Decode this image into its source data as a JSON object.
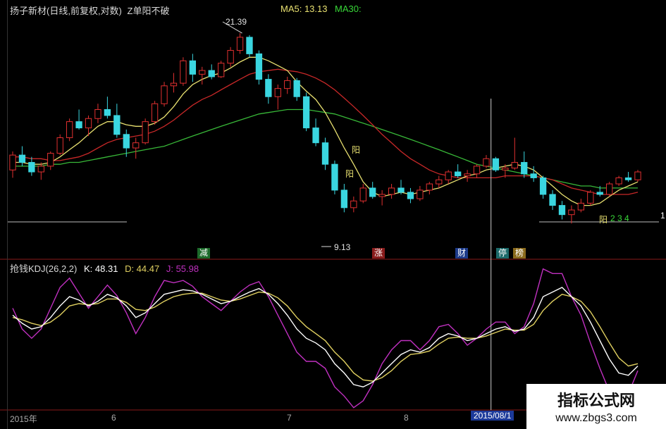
{
  "top_panel": {
    "title": "扬子新材(日线,前复权,对数)",
    "indicator": "Z单阳不破",
    "ma5_label": "MA5: 13.13",
    "ma30_label": "MA30:",
    "high_label": "21.39",
    "low_label": "9.13",
    "tags": [
      "减",
      "涨",
      "财",
      "停",
      "榜"
    ],
    "yang_labels": [
      "阳",
      "阳",
      "阳",
      "2 3 4"
    ],
    "right_marker": "1"
  },
  "bottom_panel": {
    "title": "抢钱KDJ(26,2,2)",
    "k_label": "K: 48.31",
    "d_label": "D: 44.47",
    "j_label": "J: 55.98"
  },
  "x_axis": {
    "labels": [
      "2015年",
      "6",
      "7",
      "8"
    ],
    "cursor_date": "2015/08/1"
  },
  "watermark": {
    "line1": "指标公式网",
    "line2": "www.zbgs3.com"
  },
  "colors": {
    "up": "#e03030",
    "down": "#3ad6e0",
    "ma5": "#e8e070",
    "ma10": "#c82828",
    "ma30": "#38b838",
    "k": "#ffffff",
    "d": "#e0d060",
    "j": "#c030c0"
  },
  "chart_data": [
    {
      "type": "candlestick",
      "title": "扬子新材(日线,前复权,对数)",
      "ylim": [
        8.5,
        23
      ],
      "log_scale": true,
      "x_ticks": [
        "2015年",
        "6",
        "7",
        "8"
      ],
      "ohlc": [
        [
          11.6,
          12.6,
          11.2,
          12.4
        ],
        [
          12.4,
          12.9,
          11.8,
          12.0
        ],
        [
          12.0,
          12.3,
          11.3,
          11.5
        ],
        [
          11.5,
          12.0,
          11.1,
          11.8
        ],
        [
          11.8,
          12.6,
          11.6,
          12.5
        ],
        [
          12.5,
          13.6,
          12.4,
          13.4
        ],
        [
          13.4,
          14.6,
          13.2,
          14.4
        ],
        [
          14.4,
          15.2,
          13.9,
          14.0
        ],
        [
          14.0,
          14.8,
          13.5,
          14.6
        ],
        [
          14.6,
          15.6,
          14.3,
          15.2
        ],
        [
          15.2,
          16.1,
          14.6,
          14.8
        ],
        [
          14.8,
          15.6,
          13.4,
          13.6
        ],
        [
          13.6,
          13.9,
          12.3,
          12.8
        ],
        [
          12.8,
          13.4,
          12.2,
          13.1
        ],
        [
          13.1,
          14.6,
          13.0,
          14.4
        ],
        [
          14.4,
          15.8,
          14.2,
          15.6
        ],
        [
          15.6,
          17.2,
          15.4,
          16.9
        ],
        [
          16.9,
          17.9,
          16.4,
          17.1
        ],
        [
          17.1,
          19.2,
          16.9,
          18.9
        ],
        [
          18.9,
          19.5,
          17.2,
          17.8
        ],
        [
          17.8,
          18.4,
          17.0,
          18.1
        ],
        [
          18.1,
          18.6,
          17.4,
          17.6
        ],
        [
          17.6,
          18.9,
          17.5,
          18.7
        ],
        [
          18.7,
          20.1,
          18.4,
          19.8
        ],
        [
          19.8,
          21.39,
          19.5,
          21.0
        ],
        [
          21.0,
          21.2,
          19.2,
          19.5
        ],
        [
          19.5,
          19.8,
          17.0,
          17.4
        ],
        [
          17.4,
          17.8,
          15.6,
          16.1
        ],
        [
          16.1,
          17.0,
          15.2,
          16.7
        ],
        [
          16.7,
          17.6,
          16.3,
          17.3
        ],
        [
          17.3,
          17.5,
          15.8,
          16.1
        ],
        [
          16.1,
          16.4,
          13.8,
          14.0
        ],
        [
          14.0,
          14.6,
          12.9,
          13.1
        ],
        [
          13.1,
          13.4,
          11.6,
          11.9
        ],
        [
          11.9,
          12.1,
          10.4,
          10.6
        ],
        [
          10.6,
          10.9,
          9.6,
          9.8
        ],
        [
          9.8,
          10.3,
          9.6,
          10.1
        ],
        [
          10.1,
          10.9,
          10.0,
          10.7
        ],
        [
          10.7,
          11.0,
          10.2,
          10.3
        ],
        [
          10.3,
          10.6,
          9.9,
          10.4
        ],
        [
          10.4,
          10.9,
          10.2,
          10.7
        ],
        [
          10.7,
          11.1,
          10.4,
          10.5
        ],
        [
          10.5,
          10.7,
          10.0,
          10.2
        ],
        [
          10.2,
          10.8,
          10.1,
          10.6
        ],
        [
          10.6,
          11.0,
          10.4,
          10.9
        ],
        [
          10.9,
          11.3,
          10.7,
          11.1
        ],
        [
          11.1,
          11.6,
          10.9,
          11.5
        ],
        [
          11.5,
          11.9,
          11.2,
          11.3
        ],
        [
          11.3,
          11.6,
          11.0,
          11.4
        ],
        [
          11.4,
          11.9,
          11.2,
          11.8
        ],
        [
          11.8,
          12.4,
          11.7,
          12.2
        ],
        [
          12.2,
          12.3,
          11.5,
          11.6
        ],
        [
          11.6,
          11.9,
          11.2,
          11.7
        ],
        [
          11.7,
          13.4,
          11.6,
          12.0
        ],
        [
          12.0,
          12.6,
          11.2,
          11.4
        ],
        [
          11.4,
          11.8,
          11.0,
          11.2
        ],
        [
          11.2,
          11.3,
          10.2,
          10.4
        ],
        [
          10.4,
          10.6,
          9.7,
          9.9
        ],
        [
          9.9,
          10.1,
          9.3,
          9.5
        ],
        [
          9.5,
          9.9,
          9.13,
          9.7
        ],
        [
          9.7,
          10.2,
          9.6,
          10.0
        ],
        [
          10.0,
          10.6,
          9.9,
          10.5
        ],
        [
          10.5,
          10.8,
          10.3,
          10.4
        ],
        [
          10.4,
          11.0,
          10.3,
          10.9
        ],
        [
          10.9,
          11.3,
          10.8,
          11.2
        ],
        [
          11.2,
          11.5,
          11.0,
          11.1
        ],
        [
          11.1,
          11.6,
          11.0,
          11.5
        ]
      ],
      "ma5": [
        12.0,
        12.0,
        11.9,
        11.9,
        12.0,
        12.3,
        12.7,
        13.1,
        13.6,
        14.1,
        14.4,
        14.4,
        14.2,
        14.1,
        14.1,
        14.3,
        14.7,
        15.4,
        16.3,
        17.0,
        17.4,
        17.7,
        17.9,
        18.3,
        18.8,
        19.2,
        19.2,
        18.9,
        18.5,
        18.1,
        17.2,
        16.5,
        15.9,
        15.0,
        13.9,
        12.8,
        11.9,
        11.0,
        10.5,
        10.3,
        10.4,
        10.5,
        10.4,
        10.5,
        10.6,
        10.7,
        10.9,
        11.1,
        11.3,
        11.4,
        11.6,
        11.7,
        11.8,
        11.9,
        11.8,
        11.6,
        11.2,
        10.8,
        10.4,
        10.1,
        9.9,
        9.9,
        10.0,
        10.3,
        10.6,
        10.8,
        11.0
      ],
      "ma10": [
        12.3,
        12.3,
        12.2,
        12.2,
        12.1,
        12.1,
        12.2,
        12.3,
        12.5,
        12.8,
        13.1,
        13.3,
        13.4,
        13.5,
        13.6,
        13.8,
        14.1,
        14.5,
        15.0,
        15.5,
        15.9,
        16.2,
        16.6,
        17.0,
        17.4,
        17.8,
        18.0,
        18.1,
        18.2,
        18.1,
        18.0,
        17.8,
        17.5,
        17.1,
        16.6,
        16.0,
        15.4,
        14.8,
        14.2,
        13.6,
        13.1,
        12.6,
        12.2,
        11.9,
        11.6,
        11.4,
        11.3,
        11.2,
        11.2,
        11.2,
        11.2,
        11.2,
        11.3,
        11.3,
        11.3,
        11.3,
        11.2,
        11.1,
        10.9,
        10.7,
        10.6,
        10.5,
        10.4,
        10.4,
        10.4,
        10.4,
        10.5
      ],
      "ma30": [
        11.8,
        11.8,
        11.8,
        11.8,
        11.9,
        11.9,
        12.0,
        12.0,
        12.1,
        12.2,
        12.3,
        12.4,
        12.5,
        12.6,
        12.7,
        12.8,
        12.9,
        13.1,
        13.3,
        13.5,
        13.7,
        13.9,
        14.1,
        14.3,
        14.5,
        14.7,
        14.9,
        15.0,
        15.1,
        15.2,
        15.2,
        15.2,
        15.1,
        15.0,
        14.9,
        14.7,
        14.5,
        14.3,
        14.1,
        13.9,
        13.7,
        13.5,
        13.3,
        13.1,
        12.9,
        12.7,
        12.5,
        12.3,
        12.1,
        11.9,
        11.8,
        11.7,
        11.6,
        11.5,
        11.4,
        11.3,
        11.2,
        11.1,
        11.0,
        10.9,
        10.8,
        10.8,
        10.7,
        10.7,
        10.7,
        10.7,
        10.7
      ],
      "annotations": {
        "high": 21.39,
        "low": 9.13
      }
    },
    {
      "type": "line",
      "title": "抢钱KDJ(26,2,2)",
      "ylim": [
        -10,
        110
      ],
      "series": [
        {
          "name": "K",
          "values": [
            72,
            65,
            60,
            62,
            70,
            80,
            88,
            85,
            80,
            84,
            90,
            87,
            80,
            70,
            74,
            82,
            90,
            92,
            94,
            93,
            90,
            86,
            82,
            84,
            88,
            92,
            95,
            90,
            82,
            72,
            60,
            52,
            48,
            42,
            30,
            22,
            12,
            10,
            14,
            22,
            30,
            38,
            42,
            40,
            44,
            52,
            56,
            54,
            50,
            52,
            56,
            60,
            62,
            58,
            60,
            70,
            88,
            92,
            96,
            88,
            80,
            66,
            50,
            34,
            22,
            20,
            28
          ]
        },
        {
          "name": "D",
          "values": [
            70,
            68,
            65,
            63,
            66,
            72,
            80,
            82,
            81,
            82,
            86,
            86,
            83,
            77,
            76,
            79,
            84,
            88,
            90,
            91,
            91,
            88,
            85,
            84,
            86,
            89,
            92,
            91,
            87,
            80,
            70,
            62,
            56,
            50,
            40,
            32,
            22,
            16,
            15,
            18,
            24,
            32,
            38,
            39,
            41,
            47,
            52,
            53,
            52,
            52,
            54,
            57,
            60,
            59,
            59,
            64,
            76,
            84,
            90,
            88,
            84,
            75,
            62,
            48,
            35,
            28,
            30
          ]
        },
        {
          "name": "J",
          "values": [
            78,
            60,
            52,
            60,
            78,
            96,
            104,
            91,
            78,
            88,
            98,
            89,
            74,
            56,
            70,
            88,
            102,
            100,
            102,
            97,
            88,
            82,
            76,
            84,
            92,
            98,
            101,
            88,
            72,
            56,
            40,
            32,
            32,
            26,
            10,
            2,
            -8,
            -2,
            12,
            30,
            42,
            50,
            50,
            42,
            50,
            62,
            64,
            56,
            46,
            52,
            60,
            66,
            66,
            56,
            62,
            82,
            112,
            108,
            108,
            88,
            72,
            48,
            26,
            6,
            -4,
            4,
            24
          ]
        }
      ],
      "k_last": 48.31,
      "d_last": 44.47,
      "j_last": 55.98
    }
  ]
}
